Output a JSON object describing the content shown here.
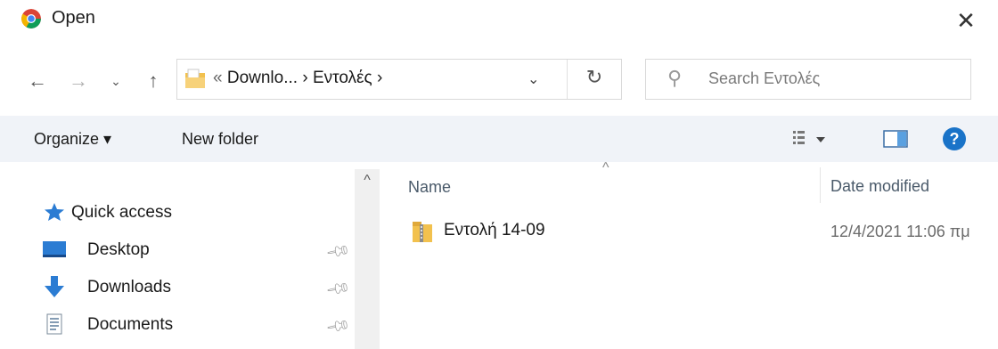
{
  "window": {
    "title": "Open"
  },
  "nav": {
    "back_icon": "arrow-left-icon",
    "forward_icon": "arrow-right-icon",
    "recent_icon": "chevron-down-icon",
    "up_icon": "arrow-up-icon"
  },
  "address": {
    "prefix": "«",
    "path": "Downlo... › Εντολές ›"
  },
  "search": {
    "placeholder": "Search Εντολές"
  },
  "toolbar": {
    "organize_label": "Organize ▾",
    "new_folder_label": "New folder"
  },
  "sidebar": {
    "items": [
      {
        "label": "Quick access",
        "icon": "star-icon",
        "pinned": false
      },
      {
        "label": "Desktop",
        "icon": "desktop-icon",
        "pinned": true
      },
      {
        "label": "Downloads",
        "icon": "download-arrow-icon",
        "pinned": true
      },
      {
        "label": "Documents",
        "icon": "document-icon",
        "pinned": true
      }
    ]
  },
  "columns": {
    "name": "Name",
    "date_modified": "Date modified"
  },
  "files": [
    {
      "name": "Εντολή 14-09",
      "date_modified": "12/4/2021 11:06 πμ",
      "icon": "zip-folder-icon"
    }
  ],
  "colors": {
    "accent": "#1a73c8",
    "toolbar_bg": "#f0f3f8",
    "folder": "#f2c14e"
  }
}
